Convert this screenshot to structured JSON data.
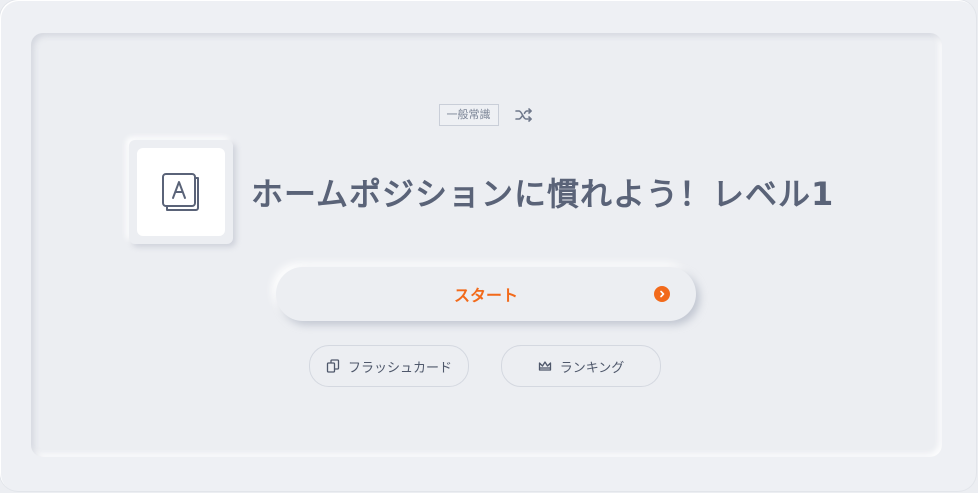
{
  "card": {
    "category": "一般常識",
    "title": "ホームポジションに慣れよう！レベル1",
    "icon": "keyboard-key-icon",
    "icon_letter": "A"
  },
  "actions": {
    "start_label": "スタート",
    "flashcard_label": "フラッシュカード",
    "ranking_label": "ランキング"
  },
  "icons": {
    "shuffle": "shuffle-icon",
    "start_arrow": "chevron-right-icon",
    "flashcard": "cards-icon",
    "ranking": "crown-icon"
  },
  "colors": {
    "accent": "#f26a1b",
    "text": "#5a6378",
    "background": "#eceef2"
  }
}
